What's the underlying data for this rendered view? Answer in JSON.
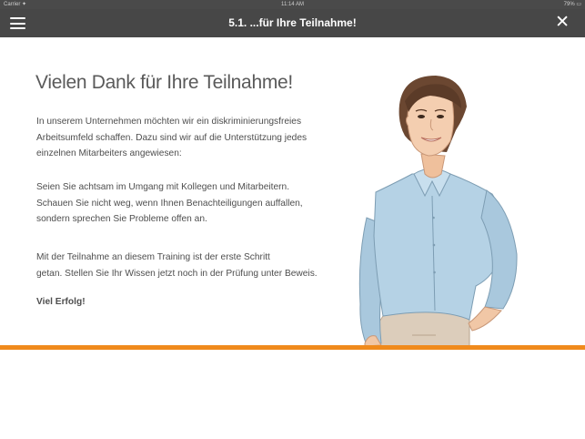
{
  "status_bar": {
    "carrier": "Carrier ✦",
    "time": "11:14 AM",
    "battery": "79% ▭"
  },
  "nav": {
    "title": "5.1. ...für Ihre Teilnahme!",
    "menu_icon": "hamburger-menu-icon",
    "close_icon": "close-icon"
  },
  "content": {
    "heading": "Vielen Dank für Ihre Teilnahme!",
    "p1": [
      "In unserem Unternehmen möchten wir ein diskriminierungsfreies",
      "Arbeitsumfeld schaffen. Dazu sind wir auf die Unterstützung jedes",
      "einzelnen Mitarbeiters angewiesen:"
    ],
    "p2": [
      "Seien Sie achtsam im Umgang mit Kollegen und Mitarbeitern.",
      "Schauen Sie nicht weg, wenn Ihnen Benachteiligungen auffallen,",
      "sondern sprechen Sie Probleme offen an."
    ],
    "p3": [
      "Mit der Teilnahme an diesem Training ist der erste Schritt",
      "getan. Stellen Sie Ihr Wissen jetzt noch in der Prüfung unter Beweis."
    ],
    "closing": "Viel Erfolg!"
  },
  "colors": {
    "nav_bg": "#474747",
    "accent": "#f08a1c",
    "text": "#4e4e4e"
  }
}
